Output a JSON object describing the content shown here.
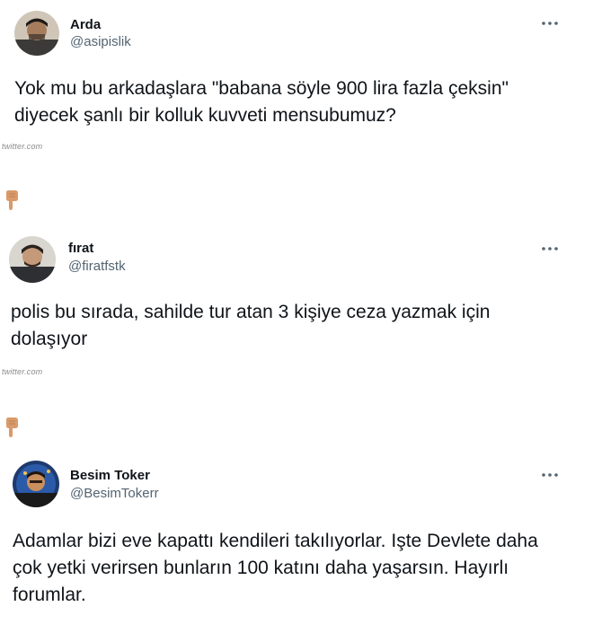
{
  "tweets": [
    {
      "name": "Arda",
      "handle": "@asipislik",
      "text": "Yok mu bu arkadaşlara \"babana söyle 900 lira fazla çeksin\" diyecek şanlı bir kolluk kuvveti mensubumuz?",
      "source": "twitter.com"
    },
    {
      "name": "fırat",
      "handle": "@firatfstk",
      "text": "polis bu sırada, sahilde tur atan 3 kişiye ceza yazmak için dolaşıyor",
      "source": "twitter.com"
    },
    {
      "name": "Besim Toker",
      "handle": "@BesimTokerr",
      "text": "Adamlar bizi eve kapattı kendileri takılıyorlar. Işte Devlete daha çok yetki verirsen bunların 100 katını daha yaşarsın. Hayırlı forumlar."
    }
  ],
  "icons": {
    "more": "more-options-icon",
    "pointer": "pointing-down-hand-icon"
  },
  "colors": {
    "text": "#0f1419",
    "secondary": "#536471",
    "source": "#8a8a8a"
  }
}
